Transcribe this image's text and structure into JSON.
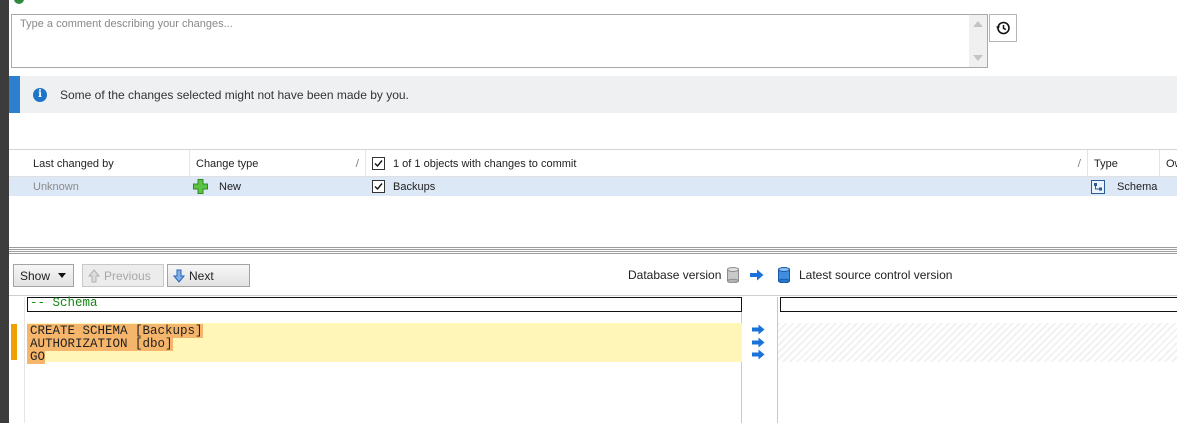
{
  "comment": {
    "placeholder": "Type a comment describing your changes...",
    "value": ""
  },
  "history_icon": "history-icon",
  "info_banner": {
    "text": "Some of the changes selected might not have been made by you.",
    "accent": "#2f7fd1"
  },
  "grid": {
    "columns": {
      "last_changed_by": "Last changed by",
      "change_type": "Change type",
      "objects": "1 of 1 objects with changes to commit",
      "type": "Type",
      "owner": "Ow"
    },
    "sort_mark": "/",
    "rows": [
      {
        "last_changed_by": "Unknown",
        "change_type": "New",
        "object": "Backups",
        "type": "Schema",
        "checked": true
      }
    ]
  },
  "toolbar": {
    "show_label": "Show",
    "previous_label": "Previous",
    "next_label": "Next",
    "database_version_label": "Database version",
    "source_control_label": "Latest source control version"
  },
  "diff": {
    "comment_line": "-- Schema",
    "changed_lines": [
      "CREATE SCHEMA [Backups]",
      "AUTHORIZATION [dbo]",
      "GO"
    ]
  },
  "colors": {
    "selected_row": "#dce8f6",
    "changed_block": "#fff6b8",
    "changed_text_bg": "#f5b66b",
    "gutter_mark": "#f0a000",
    "arrow_blue": "#1a73d9"
  }
}
